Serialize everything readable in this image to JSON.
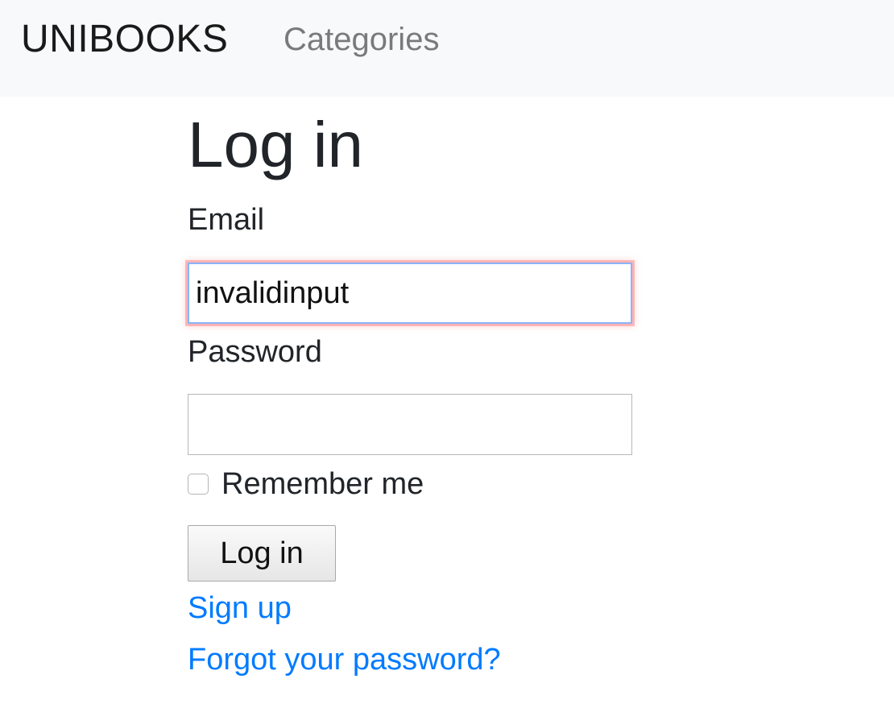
{
  "navbar": {
    "brand": "UNIBOOKS",
    "links": [
      "Categories"
    ]
  },
  "login": {
    "title": "Log in",
    "email_label": "Email",
    "email_value": "invalidinput",
    "password_label": "Password",
    "password_value": "",
    "remember_label": "Remember me",
    "remember_checked": false,
    "submit_label": "Log in",
    "signup_link": "Sign up",
    "forgot_link": "Forgot your password?"
  },
  "colors": {
    "navbar_bg": "#f8f9fa",
    "link": "#007bff",
    "invalid_glow": "#ff7878",
    "focus_border": "#8ab4f8"
  }
}
